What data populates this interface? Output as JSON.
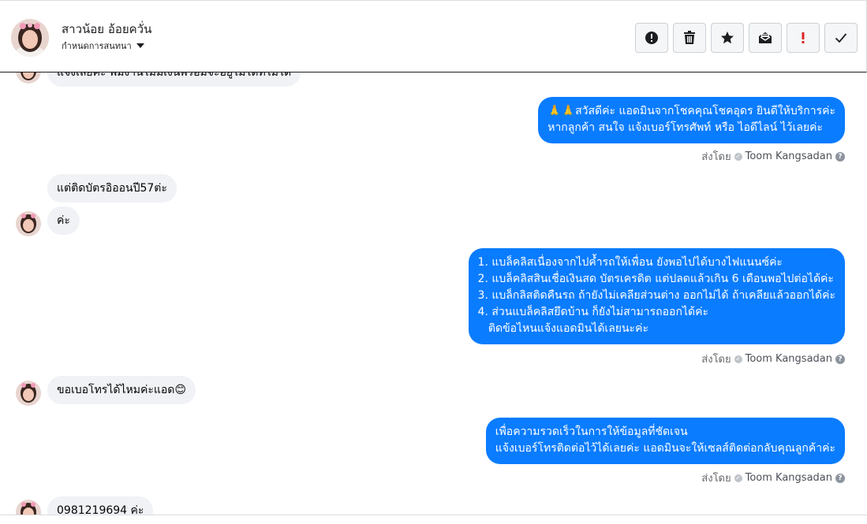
{
  "header": {
    "name": "สาวน้อย อ้อยควั่น",
    "subtitle": "กำหนดการสนทนา",
    "actions": [
      {
        "name": "spam-report-button",
        "icon": "alert-circle-icon"
      },
      {
        "name": "delete-button",
        "icon": "trash-icon"
      },
      {
        "name": "star-button",
        "icon": "star-icon"
      },
      {
        "name": "mark-unread-button",
        "icon": "envelope-icon"
      },
      {
        "name": "follow-up-button",
        "icon": "exclamation-icon"
      },
      {
        "name": "mark-done-button",
        "icon": "check-icon"
      }
    ]
  },
  "messages": {
    "in_top_partial": "แจ้งเลยค่ะ พี่มีงานไม่มีเงินพร้อมจะอยู่ไม่ได้ที่ไม่ได้",
    "out1_line1": "🙏🙏สวัสดีค่ะ แอดมินจากโชคคุณโชคอุดร ยินดีให้บริการค่ะ",
    "out1_line2": "หากลูกค้า สนใจ แจ้งเบอร์โทรศัพท์ หรือ ไอดีไลน์  ไว้เลยค่ะ",
    "in2": "แต่ติดบัตรอิออนปี57ต่ะ",
    "in3": "ค่ะ",
    "out2_line1": "1. แบล็คลิสเนื่องจากไปค้ำรถให้เพื่อน ยังพอไปได้บางไฟแนนซ์ค่ะ",
    "out2_line2": "2. แบล็คลิสสินเชื่อเงินสด บัตรเครดิต แต่ปลดแล้วเกิน 6 เดือนพอไปต่อได้ค่ะ",
    "out2_line3": "3. แบล็กลิสติดคืนรถ ถ้ายังไม่เคลียส่วนต่าง ออกไม่ได้ ถ้าเคลียแล้วออกได้ค่ะ",
    "out2_line4": "4. ส่วนแบล็คลิสยึดบ้าน ก็ยังไม่สามารถออกได้ค่ะ",
    "out2_line5": "   ติดข้อไหนแจ้งแอดมินได้เลยนะค่ะ",
    "in4": "ขอเบอโทรได้ไหมค่ะแอด😊",
    "out3_line1": "เพื่อความรวดเร็วในการให้ข้อมูลที่ชัดเจน",
    "out3_line2": "แจ้งเบอร์โทรติดต่อไว้ได้เลยค่ะ แอดมินจะให้เซลส์ติดต่อกลับคุณลูกค้าค่ะ",
    "in_bottom_partial": "0981219694 ค่ะ"
  },
  "sent_by": {
    "prefix": "ส่งโดย",
    "sender": "Toom Kangsadan"
  },
  "colors": {
    "outgoing_bubble": "#0a7cff",
    "incoming_bubble": "#f0f2f5"
  }
}
